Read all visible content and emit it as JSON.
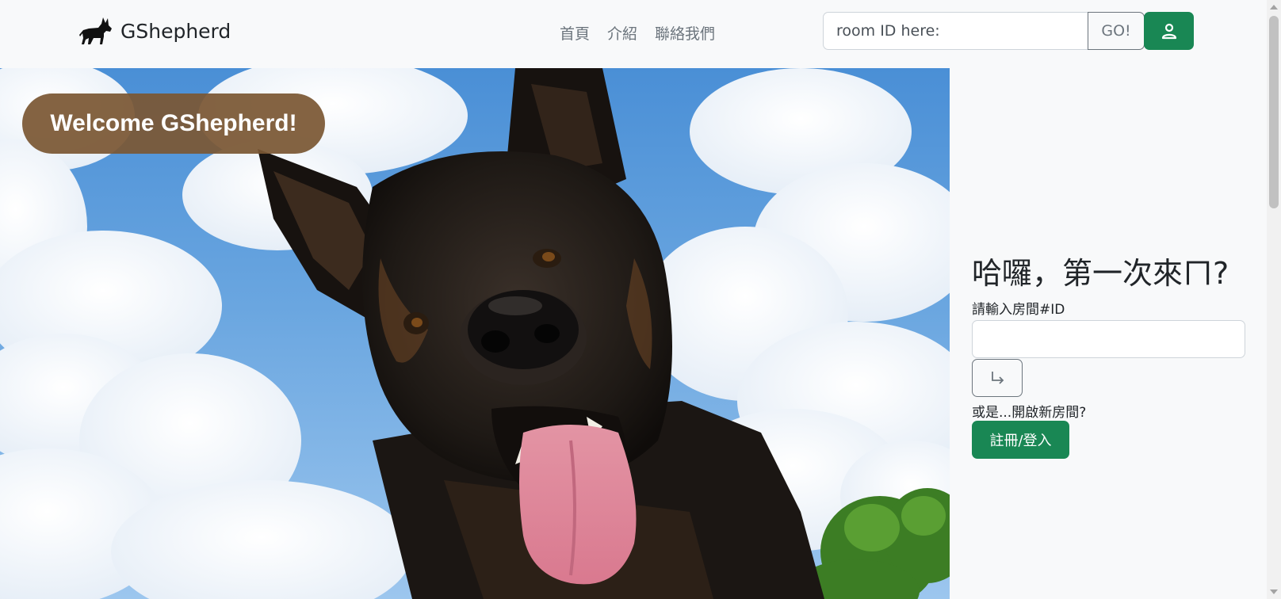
{
  "brand": {
    "name": "GShepherd",
    "logo_icon": "german-shepherd-silhouette-icon"
  },
  "nav": {
    "links": [
      {
        "label": "首頁"
      },
      {
        "label": "介紹"
      },
      {
        "label": "聯絡我們"
      }
    ]
  },
  "search": {
    "placeholder": "room ID here:",
    "value": "",
    "go_label": "GO!"
  },
  "user_button": {
    "icon": "user-icon",
    "color": "#198754"
  },
  "hero": {
    "welcome_text": "Welcome GShepherd!",
    "pill_color": "#7b5734",
    "image": "dog-photo"
  },
  "side_panel": {
    "heading": "哈囉，第一次來ㄇ?",
    "room_label": "請輸入房間#ID",
    "room_input_value": "",
    "enter_icon": "arrow-return-right-icon",
    "or_text": "或是...開啟新房間?",
    "signup_label": "註冊/登入",
    "signup_color": "#198754"
  }
}
